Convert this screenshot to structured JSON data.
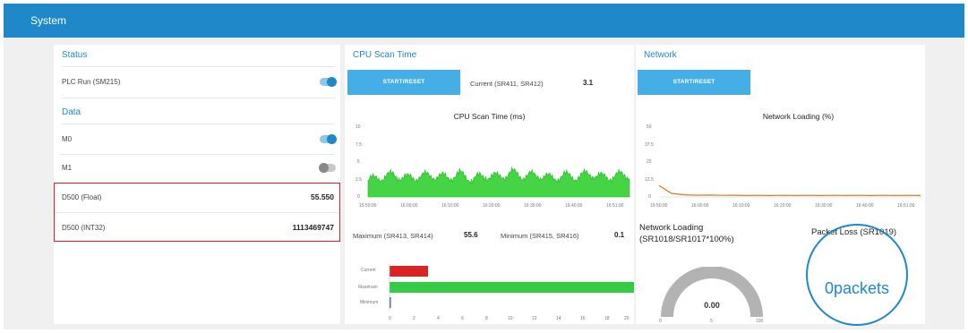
{
  "window": {
    "title": "System"
  },
  "status": {
    "title": "Status",
    "plc_run_label": "PLC Run (SM215)"
  },
  "data_section": {
    "title": "Data",
    "m0_label": "M0",
    "m1_label": "M1",
    "d500_float_label": "D500 (Float)",
    "d500_float_value": "55.550",
    "d500_int_label": "D500 (INT32)",
    "d500_int_value": "1113469747",
    "toggles": {
      "plc_run": true,
      "m0": true,
      "m1": false
    }
  },
  "cpu": {
    "title": "CPU Scan Time",
    "button_label": "START/RESET",
    "current_label": "Current (SR411, SR412)",
    "current_value": "3.1",
    "chart_title": "CPU Scan Time (ms)",
    "maximum_label": "Maximum (SR413, SR414)",
    "maximum_value": "55.6",
    "minimum_label": "Minimum (SR415, SR416)",
    "minimum_value": "0.1"
  },
  "network": {
    "title": "Network",
    "button_label": "START/RESET",
    "chart_title": "Network Loading (%)",
    "loading_title_line1": "Network Loading",
    "loading_title_line2": "(SR1018/SR1017*100%)",
    "gauge_value": "0.00",
    "gauge_min": "0",
    "gauge_mid": "5",
    "gauge_max": "100",
    "packet_loss_title": "Packet Loss (SR1019)",
    "packet_loss_value": "0packets"
  },
  "colors": {
    "accent": "#1e88c8",
    "cpu_series": "#33cc33",
    "net_series": "#e07820",
    "highlight": "#e02020",
    "bar_current": "#dd2222",
    "bar_maximum": "#33cc44",
    "bar_minimum": "#3355cc"
  },
  "chart_data": [
    {
      "type": "area",
      "title": "CPU Scan Time (ms)",
      "x": [
        "15:50:00",
        "16:00:00",
        "16:10:00",
        "16:20:00",
        "16:30:00",
        "16:40:00",
        "16:51:00"
      ],
      "series": [
        {
          "values": [
            2.3,
            2.8,
            3.1,
            2.6,
            2.9,
            3.0,
            2.7,
            3.2,
            2.5,
            3.0,
            2.8,
            3.4,
            2.9,
            3.1,
            2.6,
            3.0,
            2.8,
            3.3,
            2.7,
            3.0,
            3.1
          ]
        }
      ],
      "y_ticks": [
        "0",
        "2.5",
        "5",
        "7.5",
        "10"
      ],
      "ylim": [
        0,
        10
      ],
      "grid": true
    },
    {
      "type": "line",
      "title": "Network Loading (%)",
      "x": [
        "15:50:00",
        "16:00:00",
        "16:10:00",
        "16:20:00",
        "16:30:00",
        "16:40:00",
        "16:51:00"
      ],
      "series": [
        {
          "values": [
            8,
            2.5,
            1.5,
            1.2,
            1.3,
            1.1,
            1.2,
            1.0,
            1.1,
            1.0,
            1.1,
            1.0,
            1.1,
            1.0,
            1.1,
            1.0,
            1.1,
            1.0,
            1.1,
            1.0,
            1.1,
            1.0
          ]
        }
      ],
      "y_ticks": [
        "0",
        "12.5",
        "25",
        "37.5",
        "50"
      ],
      "ylim": [
        0,
        50
      ],
      "grid": true
    },
    {
      "type": "bar",
      "orientation": "horizontal",
      "categories": [
        "Current",
        "Maximum",
        "Minimum"
      ],
      "values": [
        3.1,
        55.6,
        0.1
      ],
      "x_ticks": [
        "0",
        "2",
        "4",
        "6",
        "8",
        "10",
        "12",
        "14",
        "16",
        "18",
        "20"
      ],
      "xlim": [
        0,
        20
      ]
    }
  ]
}
